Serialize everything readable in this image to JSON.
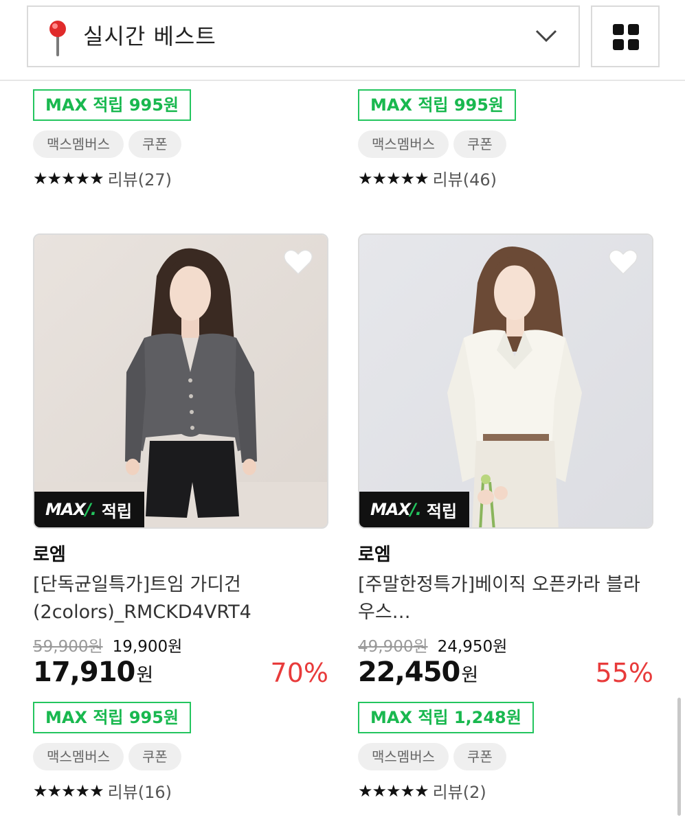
{
  "header": {
    "category_label": "실시간 베스트",
    "pin_icon": "location-pin-icon",
    "dropdown_icon": "chevron-down-icon",
    "view_toggle_icon": "grid-view-icon"
  },
  "colors": {
    "accent_green": "#23c55e",
    "discount_red": "#e83b3b"
  },
  "top_row": [
    {
      "max_badge": "MAX 적립 995원",
      "chips": [
        "맥스멤버스",
        "쿠폰"
      ],
      "stars": "★★★★★",
      "reviews": "리뷰(27)"
    },
    {
      "max_badge": "MAX 적립 995원",
      "chips": [
        "맥스멤버스",
        "쿠폰"
      ],
      "stars": "★★★★★",
      "reviews": "리뷰(46)"
    }
  ],
  "products": [
    {
      "tag_logo": "MAX",
      "tag_logo_slash": "/.",
      "tag_text": "적립",
      "brand": "로엠",
      "title": "[단독균일특가]트임 가디건(2colors)_RMCKD4VRT4",
      "original_price": "59,900원",
      "sale_price": "19,900원",
      "final_price": "17,910",
      "currency": "원",
      "discount": "70%",
      "max_badge": "MAX 적립 995원",
      "chips": [
        "맥스멤버스",
        "쿠폰"
      ],
      "stars": "★★★★★",
      "reviews": "리뷰(16)"
    },
    {
      "tag_logo": "MAX",
      "tag_logo_slash": "/.",
      "tag_text": "적립",
      "brand": "로엠",
      "title": "[주말한정특가]베이직 오픈카라 블라우스…",
      "original_price": "49,900원",
      "sale_price": "24,950원",
      "final_price": "22,450",
      "currency": "원",
      "discount": "55%",
      "max_badge": "MAX 적립 1,248원",
      "chips": [
        "맥스멤버스",
        "쿠폰"
      ],
      "stars": "★★★★★",
      "reviews": "리뷰(2)"
    }
  ]
}
